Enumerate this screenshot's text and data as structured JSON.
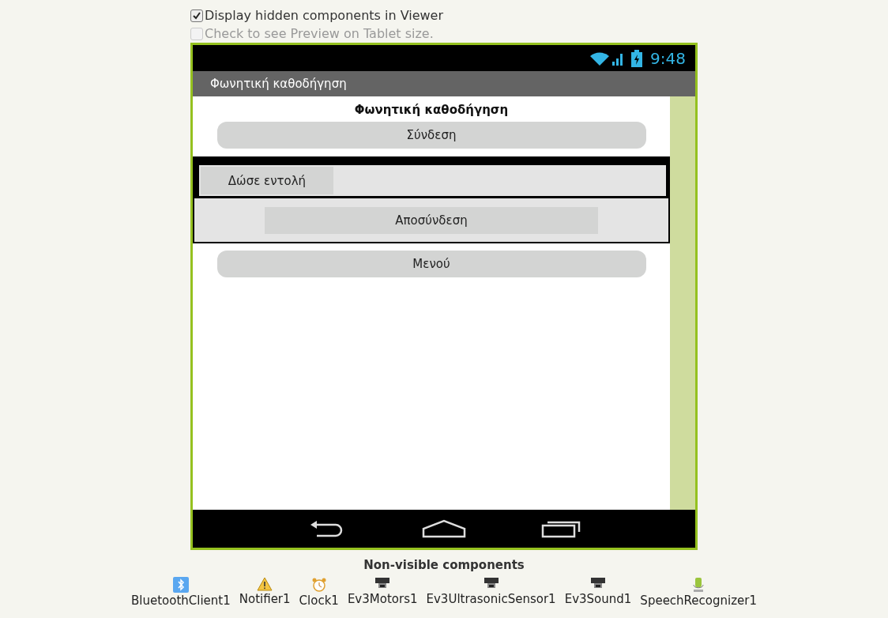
{
  "options": [
    {
      "label": "Display hidden components in Viewer",
      "checked": true,
      "disabled": false
    },
    {
      "label": "Check to see Preview on Tablet size.",
      "checked": false,
      "disabled": true
    }
  ],
  "phone": {
    "status_time": "9:48",
    "title_bar": "Φωνητική καθοδήγηση",
    "content": [
      {
        "kind": "label",
        "text": "Φωνητική καθοδήγηση"
      },
      {
        "kind": "button",
        "text": "Σύνδεση"
      },
      {
        "kind": "arrangement",
        "rows": [
          {
            "kind": "command",
            "button": "Δώσε εντολή"
          },
          {
            "kind": "centered",
            "button": "Αποσύνδεση"
          }
        ]
      },
      {
        "kind": "button",
        "text": "Μενού"
      }
    ]
  },
  "non_visible": {
    "title": "Non-visible components",
    "items": [
      {
        "kind": "bluetooth",
        "label": "BluetoothClient1"
      },
      {
        "kind": "warning",
        "label": "Notifier1"
      },
      {
        "kind": "clock",
        "label": "Clock1"
      },
      {
        "kind": "ev3",
        "label": "Ev3Motors1"
      },
      {
        "kind": "ev3",
        "label": "Ev3UltrasonicSensor1"
      },
      {
        "kind": "ev3",
        "label": "Ev3Sound1"
      },
      {
        "kind": "speech",
        "label": "SpeechRecognizer1"
      }
    ]
  }
}
